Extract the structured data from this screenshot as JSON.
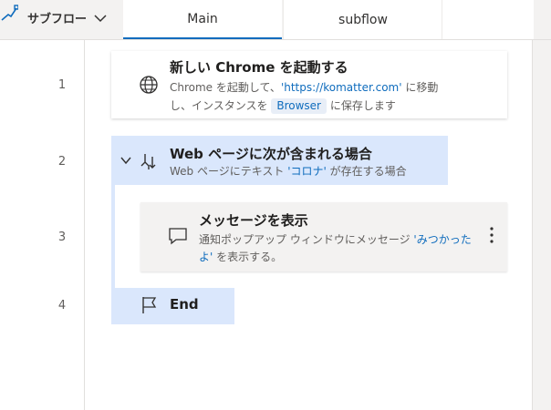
{
  "header": {
    "subflow_menu_label": "サブフロー",
    "tabs": [
      {
        "label": "Main",
        "active": true
      },
      {
        "label": "subflow",
        "active": false
      }
    ]
  },
  "line_numbers": [
    "1",
    "2",
    "3",
    "4"
  ],
  "actions": [
    {
      "title": "新しい Chrome を起動する",
      "desc_line1_pre": "Chrome を起動して、",
      "desc_line1_url": "'https://komatter.com'",
      "desc_line1_post": " に移動",
      "desc_line2_pre": "し、インスタンスを",
      "desc_line2_var": "Browser",
      "desc_line2_post": " に保存します",
      "icon": "globe-icon"
    },
    {
      "title": "Web ページに次が含まれる場合",
      "desc_pre": "Web ページにテキスト ",
      "desc_token": "'コロナ'",
      "desc_post": " が存在する場合",
      "icon": "branch-icon"
    },
    {
      "title": "メッセージを表示",
      "desc_line1_pre": "通知ポップアップ ウィンドウにメッセージ ",
      "desc_line1_token": "'みつかった",
      "desc_line2_token": "よ'",
      "desc_line2_post": " を表示する。",
      "icon": "message-icon"
    },
    {
      "title": "End",
      "icon": "flag-icon"
    }
  ],
  "colors": {
    "accent": "#0f6cbd",
    "condition_bg": "#dae7fc",
    "message_bg": "#f3f2f1"
  }
}
